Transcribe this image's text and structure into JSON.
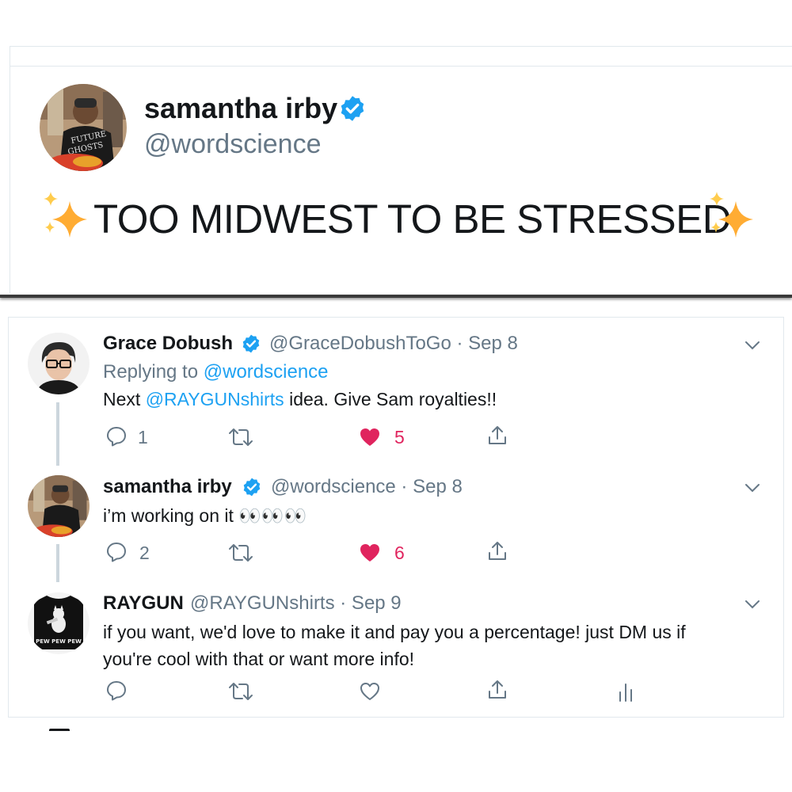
{
  "top_tweet": {
    "name": "samantha irby",
    "handle": "@wordscience",
    "text": "TOO MIDWEST TO BE STRESSED",
    "avatar_shirt_text_1": "FUTURE",
    "avatar_shirt_text_2": "GHOSTS"
  },
  "replies": [
    {
      "name": "Grace Dobush",
      "handle_date": "@GraceDobushToGo · Sep 8",
      "replying_prefix": "Replying to ",
      "replying_handle": "@wordscience",
      "text_prefix": "Next ",
      "text_link": "@RAYGUNshirts",
      "text_suffix": " idea. Give Sam royalties!!",
      "reply_count": "1",
      "like_count": "5"
    },
    {
      "name": "samantha irby",
      "handle_date": "@wordscience · Sep 8",
      "text": "i’m working on it 👀👀👀",
      "reply_count": "2",
      "like_count": "6"
    },
    {
      "name": "RAYGUN",
      "handle_date": "@RAYGUNshirts · Sep 9",
      "text_line1": "if you want, we'd love to make it and pay you a percentage! just DM us if",
      "text_line2": "you're cool with that or want more info!",
      "avatar_text": "PEW PEW PEW"
    }
  ],
  "colors": {
    "verified": "#1da1f2",
    "link": "#1da1f2",
    "like": "#e0245e",
    "secondary_text": "#657786",
    "sparkle": "#ffac33"
  }
}
